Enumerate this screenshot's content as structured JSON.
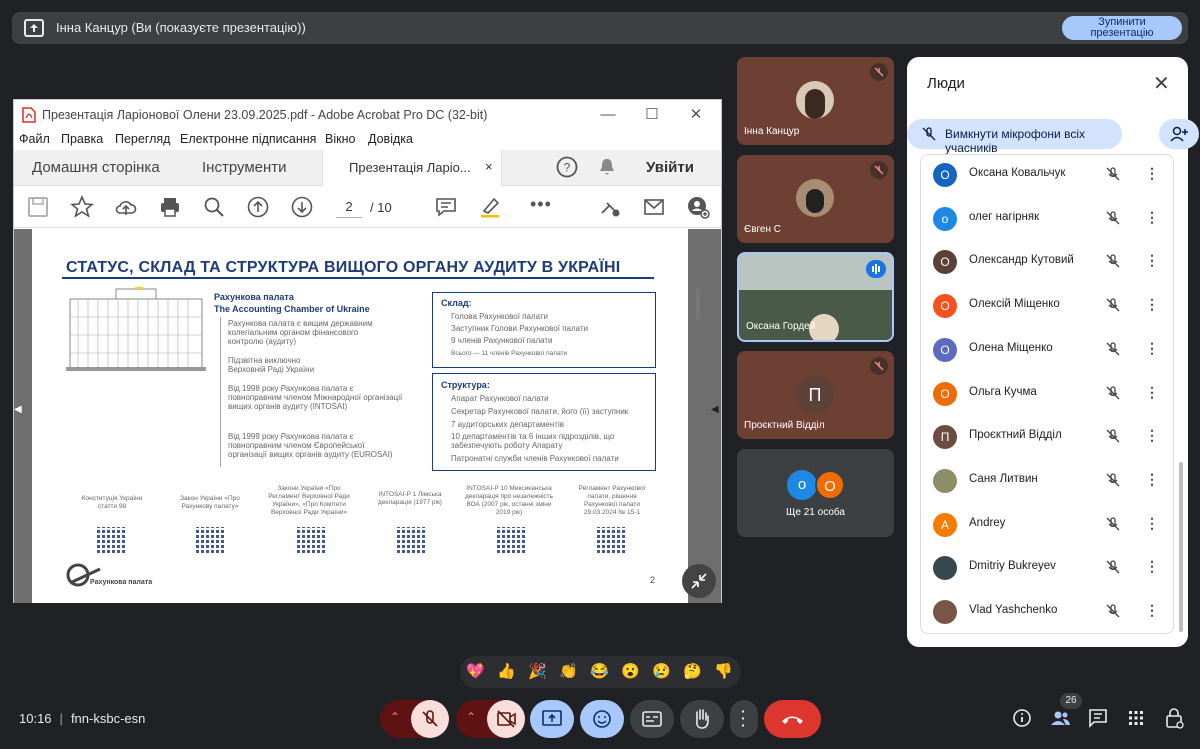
{
  "banner": {
    "title": "Інна Канцур (Ви (показуєте презентацію))",
    "stop_line1": "Зупинити",
    "stop_line2": "презентацію"
  },
  "acrobat": {
    "title": "Презентація Ларіонової Олени 23.09.2025.pdf - Adobe Acrobat Pro DC (32-bit)",
    "menu": [
      "Файл",
      "Правка",
      "Перегляд",
      "Електронне підписання",
      "Вікно",
      "Довідка"
    ],
    "tabs": {
      "home": "Домашня сторінка",
      "tools": "Інструменти",
      "doc": "Презентація Ларіо...",
      "login": "Увійти"
    },
    "page_current": "2",
    "page_total": "/ 10"
  },
  "slide": {
    "title": "СТАТУС, СКЛАД ТА СТРУКТУРА ВИЩОГО ОРГАНУ АУДИТУ В УКРАЇНІ",
    "org_name_ua": "Рахункова палата",
    "org_name_en": "The Accounting Chamber of Ukraine",
    "points": [
      "Рахункова палата є вищим державним колегіальним органом фінансового контролю (аудиту)",
      "Підзвітна виключно Верховній Раді України",
      "Від 1998 року Рахункова палата є повноправним членом Міжнародної організації вищих органів аудиту (INTOSAI)",
      "Від 1999 року Рахункова палата є повноправним членом Європейської організації вищих органів аудиту (EUROSAI)"
    ],
    "sklad_title": "Склад:",
    "sklad": [
      "Голова Рахункової палати",
      "Заступник Голови Рахункової палати",
      "9 членів Рахункової палати"
    ],
    "sklad_total": "Всього — 11 членів Рахункової палати",
    "struct_title": "Структура:",
    "struct": [
      "Апарат Рахункової палати",
      "Секретар Рахункової палати, його (її) заступник",
      "7 аудиторських департаментів",
      "10 департаментів та 6 інших підрозділів, що забезпечують роботу Апарату",
      "Патронатні служби членів Рахункової палати"
    ],
    "refs": [
      "Конституція України стаття 98",
      "Закон України «Про Рахункову палату»",
      "Закони України «Про Регламент Верховної Ради України», «Про Комітети Верховної Ради України»",
      "INTOSAI-P 1 Лімська декларація (1977 рік)",
      "INTOSAI-P 10 Мексиканська декларація про незалежність ВОА (2007 рік, останні зміни 2019 рік)",
      "Регламент Рахункової палати, рішення Рахункової палати 29.03.2024 № 15-1"
    ],
    "footer_logo": "Рахункова палата",
    "page_no": "2"
  },
  "tiles": [
    {
      "name": "Інна Канцур"
    },
    {
      "name": "Євген С"
    },
    {
      "name": "Оксана Гордей"
    },
    {
      "name": "Проєктний Відділ",
      "initial": "П"
    },
    {
      "name": "Ще 21 особа",
      "a1": "о",
      "a2": "О"
    }
  ],
  "people": {
    "title": "Люди",
    "mute_all": "Вимкнути мікрофони всіх учасників",
    "list": [
      {
        "name": "Оксана Ковальчук",
        "initial": "О",
        "color": "#1565c0"
      },
      {
        "name": "олег нагірняк",
        "initial": "о",
        "color": "#1e88e5"
      },
      {
        "name": "Олександр Кутовий",
        "initial": "О",
        "color": "#5d4037"
      },
      {
        "name": "Олексій Міщенко",
        "initial": "О",
        "color": "#f4511e"
      },
      {
        "name": "Олена Міщенко",
        "initial": "О",
        "color": "#5c6bc0"
      },
      {
        "name": "Ольга Кучма",
        "initial": "О",
        "color": "#ef6c00"
      },
      {
        "name": "Проєктний Відділ",
        "initial": "П",
        "color": "#6d4c41"
      },
      {
        "name": "Саня Литвин",
        "initial": "",
        "color": "#8d8d6a"
      },
      {
        "name": "Andrey",
        "initial": "A",
        "color": "#f57c00"
      },
      {
        "name": "Dmitriy Bukreyev",
        "initial": "",
        "color": "#37474f"
      },
      {
        "name": "Vlad Yashchenko",
        "initial": "",
        "color": "#795548"
      }
    ]
  },
  "bottom": {
    "time": "10:16",
    "meeting": "fnn-ksbc-esn",
    "participants_count": "26",
    "reactions": [
      "💖",
      "👍",
      "🎉",
      "👏",
      "😂",
      "😮",
      "😢",
      "🤔",
      "👎"
    ]
  }
}
